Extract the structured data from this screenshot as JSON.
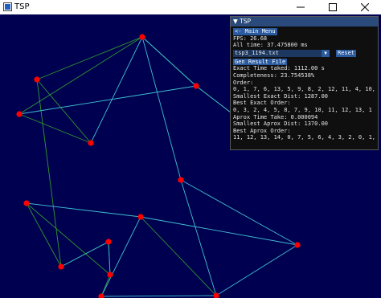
{
  "window": {
    "title": "TSP",
    "controls": {
      "minimize": "–",
      "maximize": "☐",
      "close": "✕"
    }
  },
  "colors": {
    "background": "#000050",
    "node": "#ff0000",
    "exact_edge": "#3fbfcf",
    "approx_edge": "#2f9a2f",
    "panel_header": "#294a7a",
    "button": "#2a5aa0"
  },
  "panel": {
    "header": "▼ TSP",
    "main_menu_button": "<- Main Menu",
    "fps": "FPS: 26.68",
    "all_time": "All time: 37.475800 ms",
    "file_select": "tsp3_1194.txt",
    "reset_button": "Reset",
    "gen_result_button": "Gen Result File",
    "exact_time": "Exact Time taked: 1112.00 s",
    "completeness": "Completeness: 23.754538%",
    "order_label": "Order:",
    "order_values": "0, 1, 7, 6, 13, 5, 9, 8, 2, 12, 11, 4, 10, 3,",
    "smallest_exact": "Smallest Exact Dist: 1287.00",
    "best_exact_label": "Best Exact Order:",
    "best_exact_values": "0, 3, 2, 4, 5, 8, 7, 9, 10, 11, 12, 13, 1",
    "approx_time": "Aprox Time Take: 0.000094",
    "smallest_approx": "Smallest Aprox Dist: 1370.00",
    "best_approx_label": "Best Aprox Order:",
    "best_approx_values": "11, 12, 13, 14, 0, 7, 5, 6, 4, 3, 2, 0, 1, 10"
  }
}
